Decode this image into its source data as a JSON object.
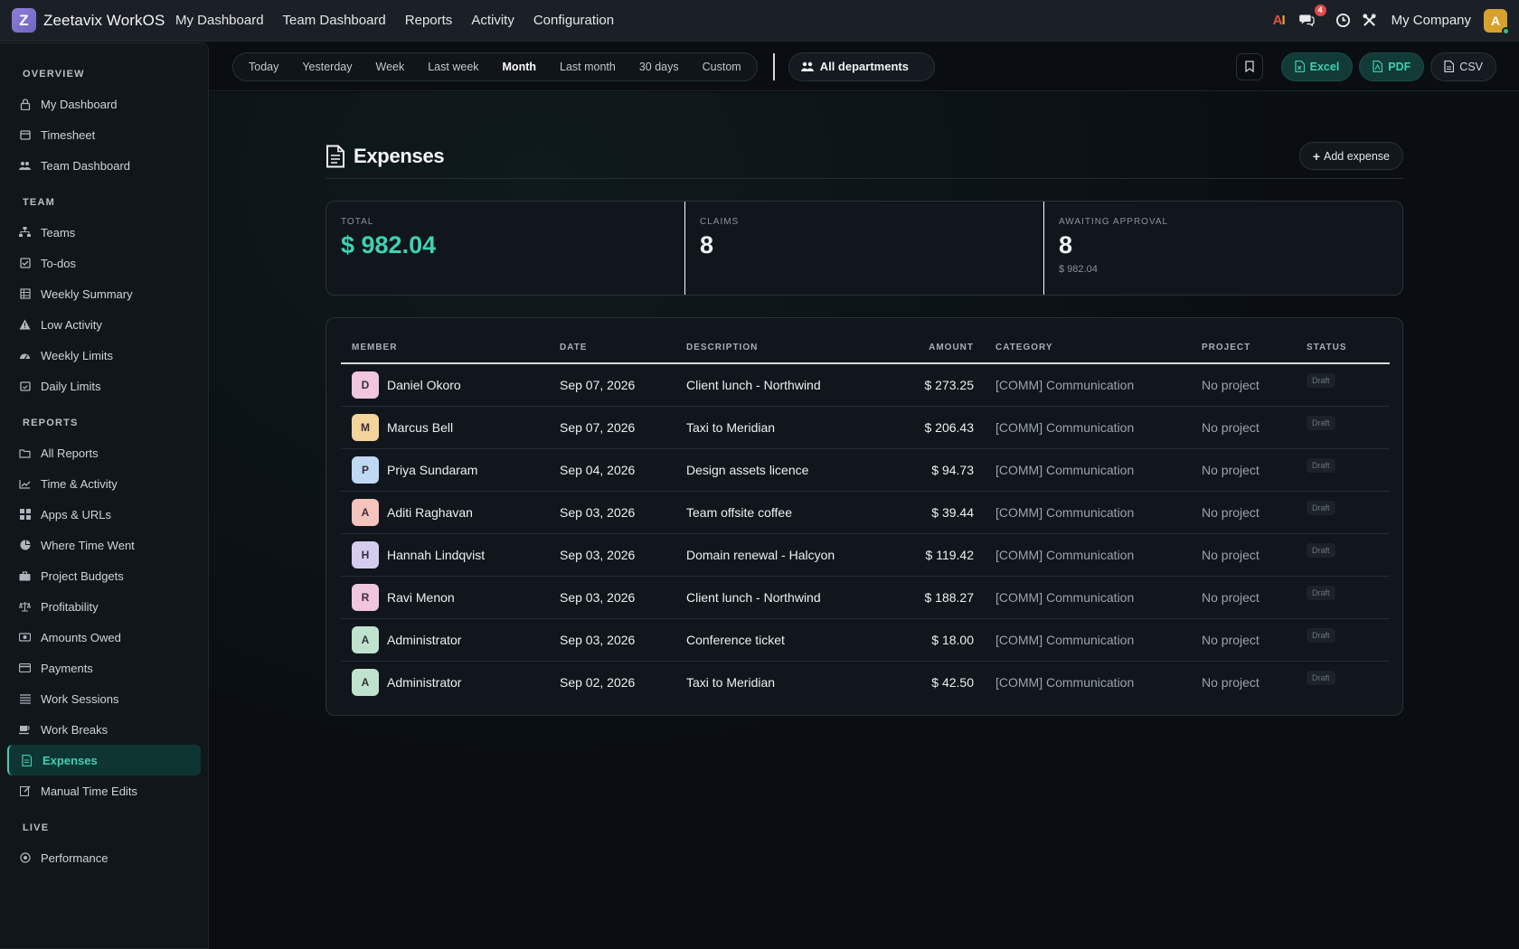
{
  "app": {
    "brand_letter": "Z",
    "brand_name": "Zeetavix WorkOS",
    "nav": [
      "My Dashboard",
      "Team Dashboard",
      "Reports",
      "Activity",
      "Configuration"
    ],
    "ai_label_a": "A",
    "ai_label_i": "I",
    "chat_badge": "4",
    "company": "My Company",
    "avatar_letter": "A"
  },
  "sidebar": {
    "sections": [
      {
        "title": "OVERVIEW",
        "items": [
          {
            "label": "My Dashboard",
            "icon": "lock-icon"
          },
          {
            "label": "Timesheet",
            "icon": "calendar-icon"
          },
          {
            "label": "Team Dashboard",
            "icon": "users-icon"
          }
        ]
      },
      {
        "title": "TEAM",
        "items": [
          {
            "label": "Teams",
            "icon": "sitemap-icon"
          },
          {
            "label": "To-dos",
            "icon": "checkbox-icon"
          },
          {
            "label": "Weekly Summary",
            "icon": "table-icon"
          },
          {
            "label": "Low Activity",
            "icon": "warning-icon"
          },
          {
            "label": "Weekly Limits",
            "icon": "gauge-icon"
          },
          {
            "label": "Daily Limits",
            "icon": "calendar-check-icon"
          }
        ]
      },
      {
        "title": "REPORTS",
        "items": [
          {
            "label": "All Reports",
            "icon": "folder-icon"
          },
          {
            "label": "Time & Activity",
            "icon": "line-chart-icon"
          },
          {
            "label": "Apps & URLs",
            "icon": "grid-icon"
          },
          {
            "label": "Where Time Went",
            "icon": "pie-chart-icon"
          },
          {
            "label": "Project Budgets",
            "icon": "briefcase-icon"
          },
          {
            "label": "Profitability",
            "icon": "scale-icon"
          },
          {
            "label": "Amounts Owed",
            "icon": "money-icon"
          },
          {
            "label": "Payments",
            "icon": "credit-card-icon"
          },
          {
            "label": "Work Sessions",
            "icon": "list-icon"
          },
          {
            "label": "Work Breaks",
            "icon": "coffee-icon"
          },
          {
            "label": "Expenses",
            "icon": "receipt-icon",
            "active": true
          },
          {
            "label": "Manual Time Edits",
            "icon": "edit-icon"
          }
        ]
      },
      {
        "title": "LIVE",
        "items": [
          {
            "label": "Performance",
            "icon": "target-icon"
          }
        ]
      }
    ]
  },
  "filters": {
    "ranges": [
      "Today",
      "Yesterday",
      "Week",
      "Last week",
      "Month",
      "Last month",
      "30 days",
      "Custom"
    ],
    "active_range": "Month",
    "department": "All departments",
    "export": {
      "excel": "Excel",
      "pdf": "PDF",
      "csv": "CSV"
    }
  },
  "page": {
    "title": "Expenses",
    "add_button": "Add expense"
  },
  "stats": {
    "total_label": "TOTAL",
    "total_value": "$ 982.04",
    "claims_label": "CLAIMS",
    "claims_value": "8",
    "awaiting_label": "AWAITING APPROVAL",
    "awaiting_value": "8",
    "awaiting_sub": "$ 982.04"
  },
  "table": {
    "columns": [
      "MEMBER",
      "DATE",
      "DESCRIPTION",
      "AMOUNT",
      "CATEGORY",
      "PROJECT",
      "STATUS"
    ],
    "rows": [
      {
        "initial": "D",
        "member": "Daniel Okoro",
        "date": "Sep 07, 2026",
        "description": "Client lunch - Northwind",
        "amount": "$ 273.25",
        "category": "[COMM] Communication",
        "project": "No project",
        "status": "Draft",
        "avatar_color": "#f0c6dc"
      },
      {
        "initial": "M",
        "member": "Marcus Bell",
        "date": "Sep 07, 2026",
        "description": "Taxi to Meridian",
        "amount": "$ 206.43",
        "category": "[COMM] Communication",
        "project": "No project",
        "status": "Draft",
        "avatar_color": "#f3d49a"
      },
      {
        "initial": "P",
        "member": "Priya Sundaram",
        "date": "Sep 04, 2026",
        "description": "Design assets licence",
        "amount": "$ 94.73",
        "category": "[COMM] Communication",
        "project": "No project",
        "status": "Draft",
        "avatar_color": "#bfd8f3"
      },
      {
        "initial": "A",
        "member": "Aditi Raghavan",
        "date": "Sep 03, 2026",
        "description": "Team offsite coffee",
        "amount": "$ 39.44",
        "category": "[COMM] Communication",
        "project": "No project",
        "status": "Draft",
        "avatar_color": "#f4c4bd"
      },
      {
        "initial": "H",
        "member": "Hannah Lindqvist",
        "date": "Sep 03, 2026",
        "description": "Domain renewal - Halcyon",
        "amount": "$ 119.42",
        "category": "[COMM] Communication",
        "project": "No project",
        "status": "Draft",
        "avatar_color": "#d4cdf0"
      },
      {
        "initial": "R",
        "member": "Ravi Menon",
        "date": "Sep 03, 2026",
        "description": "Client lunch - Northwind",
        "amount": "$ 188.27",
        "category": "[COMM] Communication",
        "project": "No project",
        "status": "Draft",
        "avatar_color": "#f0c6dc"
      },
      {
        "initial": "A",
        "member": "Administrator",
        "date": "Sep 03, 2026",
        "description": "Conference ticket",
        "amount": "$ 18.00",
        "category": "[COMM] Communication",
        "project": "No project",
        "status": "Draft",
        "avatar_color": "#bfe3cd"
      },
      {
        "initial": "A",
        "member": "Administrator",
        "date": "Sep 02, 2026",
        "description": "Taxi to Meridian",
        "amount": "$ 42.50",
        "category": "[COMM] Communication",
        "project": "No project",
        "status": "Draft",
        "avatar_color": "#bfe3cd"
      }
    ]
  }
}
